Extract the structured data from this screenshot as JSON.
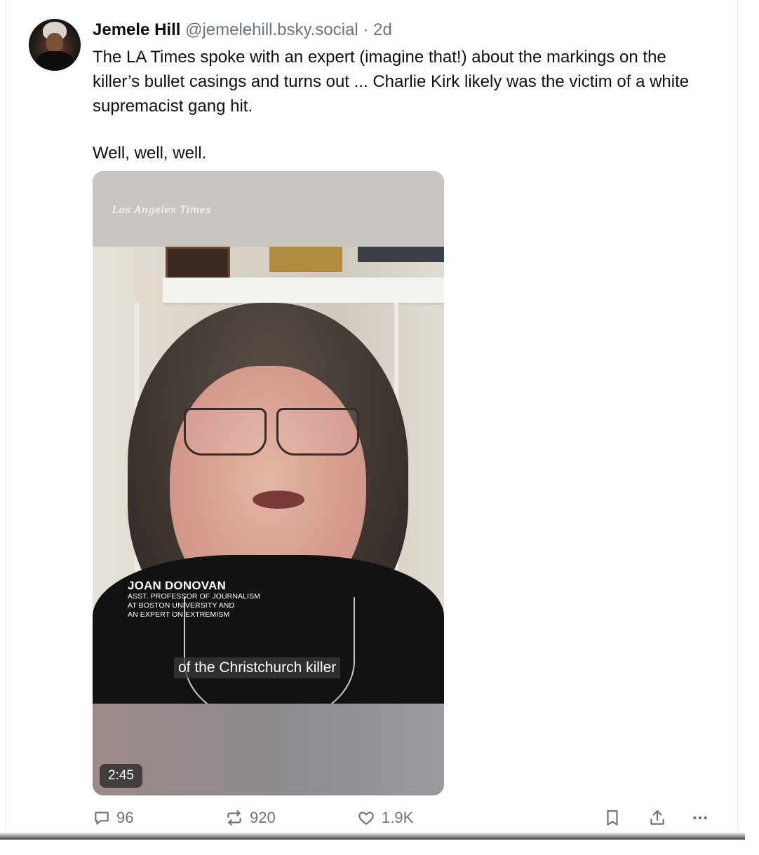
{
  "post": {
    "author": {
      "name": "Jemele Hill",
      "handle": "@jemelehill.bsky.social",
      "separator": "·",
      "time": "2d",
      "avatar_icon": "user-avatar"
    },
    "text": {
      "paragraph1": "The LA Times spoke with an expert (imagine that!) about the markings on the killer’s bullet casings and turns out ... Charlie Kirk likely was the victim of a white supremacist gang hit.",
      "paragraph2": "Well, well, well."
    },
    "video": {
      "logo": "Los Angeles Times",
      "lower_third": {
        "name": "JOAN DONOVAN",
        "line1": "ASST. PROFESSOR OF JOURNALISM",
        "line2": "AT BOSTON UNIVERSITY AND",
        "line3": "AN EXPERT ON EXTREMISM"
      },
      "caption": "of the Christchurch killer",
      "duration": "2:45"
    },
    "actions": {
      "replies": "96",
      "reposts": "920",
      "likes": "1.9K",
      "icons": [
        "reply-icon",
        "repost-icon",
        "heart-icon",
        "bookmark-icon",
        "share-icon",
        "more-icon"
      ]
    }
  },
  "colors": {
    "text": "#0b0f14",
    "muted": "#6b7280",
    "border": "#ececec"
  }
}
